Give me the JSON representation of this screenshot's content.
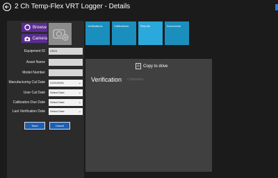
{
  "window": {
    "title": "2 Ch Temp-Flex VRT Logger - Details"
  },
  "left_panel": {
    "browse_label": "Browse",
    "camera_label": "Camera",
    "fields": {
      "equipment_id": {
        "label": "Equipment ID",
        "value": "VR23"
      },
      "asset_name": {
        "label": "Asset Name",
        "value": ""
      },
      "model_number": {
        "label": "Model Number",
        "value": ""
      },
      "manufacturing_cal_date": {
        "label": "Manufacturing Cal Date",
        "value": "01/01/0001"
      },
      "user_cal_date": {
        "label": "User Cal Date",
        "value": "Select Date"
      },
      "calibration_due_date": {
        "label": "Calibration Due Date",
        "value": "Select Date"
      },
      "last_verification_date": {
        "label": "Last Verification Date",
        "value": "Select Date"
      }
    },
    "save_label": "Save",
    "cancel_label": "Cancel"
  },
  "tabs": [
    {
      "label": "Verifications"
    },
    {
      "label": "Calibrations"
    },
    {
      "label": "Reports"
    },
    {
      "label": "Documents"
    }
  ],
  "content": {
    "copy_label": "Copy to drive",
    "active_subtab": "Verification",
    "inactive_subtab": "Calibration"
  },
  "colors": {
    "tile": "#1a8fbe",
    "tile_active": "#2aa9dc",
    "purple": "#5b2d91",
    "button_blue": "#1c5fb4"
  },
  "icons": [
    "back-arrow-icon",
    "browse-icon",
    "camera-icon",
    "add-photo-icon",
    "copy-icon",
    "chevron-down-icon"
  ]
}
